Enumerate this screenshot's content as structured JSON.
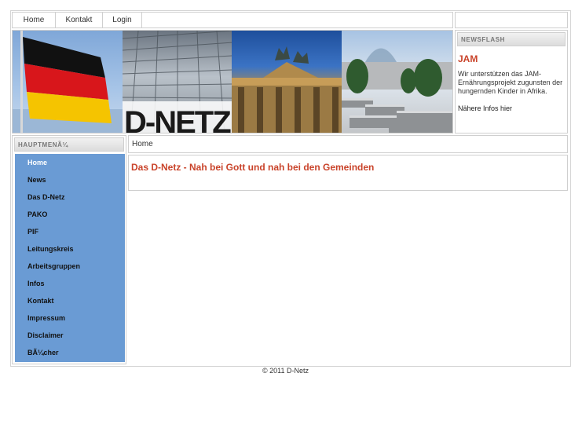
{
  "topnav": {
    "items": [
      {
        "label": "Home"
      },
      {
        "label": "Kontakt"
      },
      {
        "label": "Login"
      }
    ]
  },
  "header": {
    "logo_text": "D-NETZ"
  },
  "newsflash": {
    "title": "NEWSFLASH",
    "headline": "JAM",
    "text": "Wir unterstützen das JAM-Ernährungsprojekt zugunsten der hungernden Kinder in Afrika.",
    "more_link": "Nähere Infos hier"
  },
  "sidebar": {
    "title": "HAUPTMENÃ¼",
    "items": [
      {
        "label": "Home"
      },
      {
        "label": "News"
      },
      {
        "label": "Das D-Netz"
      },
      {
        "label": "PAKO"
      },
      {
        "label": "PIF"
      },
      {
        "label": "Leitungskreis"
      },
      {
        "label": "Arbeitsgruppen"
      },
      {
        "label": "Infos"
      },
      {
        "label": "Kontakt"
      },
      {
        "label": "Impressum"
      },
      {
        "label": "Disclaimer"
      },
      {
        "label": "BÃ¼cher"
      }
    ],
    "active_index": 0
  },
  "breadcrumb": {
    "current": "Home"
  },
  "content": {
    "heading": "Das D-Netz - Nah bei Gott und nah bei den Gemeinden"
  },
  "footer": {
    "copyright": "© 2011 D-Netz"
  },
  "colors": {
    "menu_bg": "#6a9bd4",
    "accent": "#c9432a",
    "border": "#cfcfcf"
  }
}
